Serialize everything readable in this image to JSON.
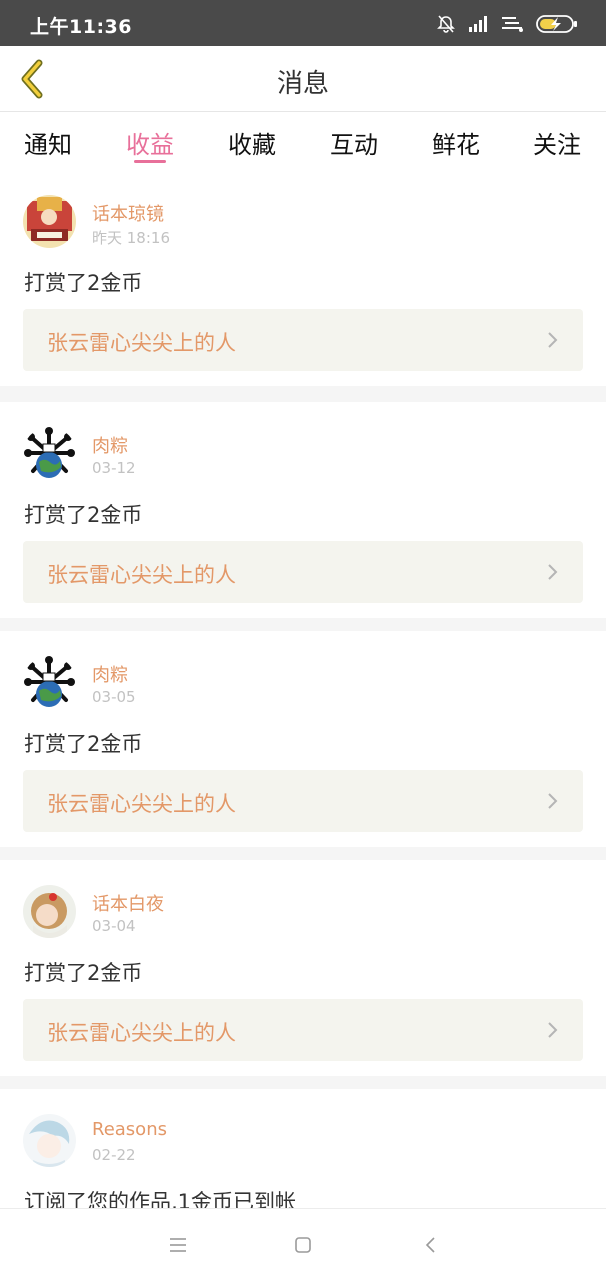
{
  "status_bar": {
    "time": "上午11:36",
    "icons": [
      "bell-off-icon",
      "signal-icon",
      "wifi-icon",
      "battery-charging-icon"
    ]
  },
  "header": {
    "title": "消息",
    "back_icon": "chevron-left-icon"
  },
  "tabs": [
    {
      "label": "通知",
      "active": false
    },
    {
      "label": "收益",
      "active": true
    },
    {
      "label": "收藏",
      "active": false
    },
    {
      "label": "互动",
      "active": false
    },
    {
      "label": "鲜花",
      "active": false
    },
    {
      "label": "关注",
      "active": false
    }
  ],
  "messages": [
    {
      "username": "话本琼镜",
      "time": "昨天 18:16",
      "text": "打赏了2金币",
      "work_title": "张云雷心尖尖上的人"
    },
    {
      "username": "肉粽",
      "time": "03-12",
      "text": "打赏了2金币",
      "work_title": "张云雷心尖尖上的人"
    },
    {
      "username": "肉粽",
      "time": "03-05",
      "text": "打赏了2金币",
      "work_title": "张云雷心尖尖上的人"
    },
    {
      "username": "话本白夜",
      "time": "03-04",
      "text": "打赏了2金币",
      "work_title": "张云雷心尖尖上的人"
    },
    {
      "username": "Reasons",
      "time": "02-22",
      "text": "订阅了您的作品,1金币已到帐",
      "work_title": ""
    }
  ],
  "bottom_nav": {
    "icons": [
      "menu-icon",
      "home-square-icon",
      "back-triangle-icon"
    ]
  },
  "colors": {
    "accent_pink": "#e8709a",
    "username_orange": "#e39868",
    "status_bar_bg": "#4a4a4a",
    "work_box_bg": "#f4f4ee"
  }
}
